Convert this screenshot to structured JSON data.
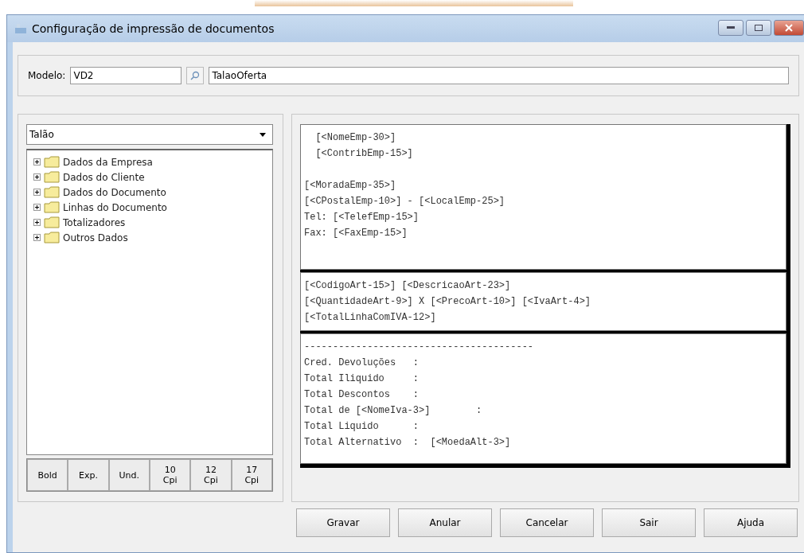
{
  "window": {
    "title": "Configuração de impressão de documentos"
  },
  "model": {
    "label": "Modelo:",
    "code": "VD2",
    "name": "TalaoOferta"
  },
  "left_panel": {
    "dropdown": {
      "value": "Talão"
    },
    "tree": [
      {
        "label": "Dados da Empresa",
        "expanded": false
      },
      {
        "label": "Dados do Cliente",
        "expanded": false
      },
      {
        "label": "Dados do Documento",
        "expanded": false
      },
      {
        "label": "Linhas do Documento",
        "expanded": false
      },
      {
        "label": "Totalizadores",
        "expanded": false
      },
      {
        "label": "Outros Dados",
        "expanded": false
      }
    ],
    "format_buttons": [
      "Bold",
      "Exp.",
      "Und.",
      "10\nCpi",
      "12\nCpi",
      "17\nCpi"
    ]
  },
  "template_sections": [
    {
      "paragraphs": [
        [
          "  [<NomeEmp-30>]",
          "  [<ContribEmp-15>]"
        ],
        [
          "[<MoradaEmp-35>]",
          "[<CPostalEmp-10>] - [<LocalEmp-25>]",
          "Tel: [<TelefEmp-15>]",
          "Fax: [<FaxEmp-15>]"
        ]
      ]
    },
    {
      "paragraphs": [
        [
          "[<CodigoArt-15>] [<DescricaoArt-23>]",
          "[<QuantidadeArt-9>] X [<PrecoArt-10>] [<IvaArt-4>]",
          "[<TotalLinhaComIVA-12>]"
        ]
      ]
    },
    {
      "paragraphs": [
        [
          "----------------------------------------",
          "Cred. Devoluções   :",
          "Total Iliquido     :",
          "Total Descontos    :",
          "Total de [<NomeIva-3>]        :",
          "Total Liquido      :",
          "Total Alternativo  :  [<MoedaAlt-3>]"
        ]
      ]
    }
  ],
  "buttons": [
    {
      "label": "Gravar"
    },
    {
      "label": "Anular"
    },
    {
      "label": "Cancelar"
    },
    {
      "label": "Sair"
    },
    {
      "label": "Ajuda"
    }
  ]
}
